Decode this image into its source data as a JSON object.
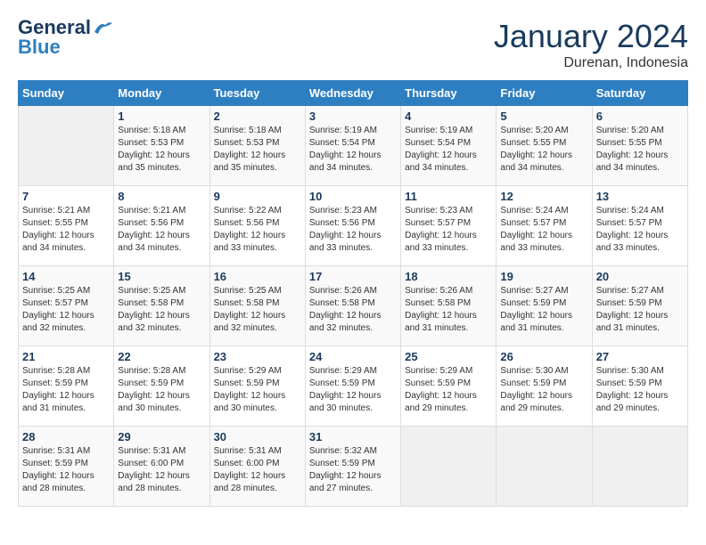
{
  "header": {
    "logo_line1": "General",
    "logo_line2": "Blue",
    "month_year": "January 2024",
    "location": "Durenan, Indonesia"
  },
  "columns": [
    "Sunday",
    "Monday",
    "Tuesday",
    "Wednesday",
    "Thursday",
    "Friday",
    "Saturday"
  ],
  "weeks": [
    [
      {
        "day": "",
        "info": ""
      },
      {
        "day": "1",
        "info": "Sunrise: 5:18 AM\nSunset: 5:53 PM\nDaylight: 12 hours\nand 35 minutes."
      },
      {
        "day": "2",
        "info": "Sunrise: 5:18 AM\nSunset: 5:53 PM\nDaylight: 12 hours\nand 35 minutes."
      },
      {
        "day": "3",
        "info": "Sunrise: 5:19 AM\nSunset: 5:54 PM\nDaylight: 12 hours\nand 34 minutes."
      },
      {
        "day": "4",
        "info": "Sunrise: 5:19 AM\nSunset: 5:54 PM\nDaylight: 12 hours\nand 34 minutes."
      },
      {
        "day": "5",
        "info": "Sunrise: 5:20 AM\nSunset: 5:55 PM\nDaylight: 12 hours\nand 34 minutes."
      },
      {
        "day": "6",
        "info": "Sunrise: 5:20 AM\nSunset: 5:55 PM\nDaylight: 12 hours\nand 34 minutes."
      }
    ],
    [
      {
        "day": "7",
        "info": "Sunrise: 5:21 AM\nSunset: 5:55 PM\nDaylight: 12 hours\nand 34 minutes."
      },
      {
        "day": "8",
        "info": "Sunrise: 5:21 AM\nSunset: 5:56 PM\nDaylight: 12 hours\nand 34 minutes."
      },
      {
        "day": "9",
        "info": "Sunrise: 5:22 AM\nSunset: 5:56 PM\nDaylight: 12 hours\nand 33 minutes."
      },
      {
        "day": "10",
        "info": "Sunrise: 5:23 AM\nSunset: 5:56 PM\nDaylight: 12 hours\nand 33 minutes."
      },
      {
        "day": "11",
        "info": "Sunrise: 5:23 AM\nSunset: 5:57 PM\nDaylight: 12 hours\nand 33 minutes."
      },
      {
        "day": "12",
        "info": "Sunrise: 5:24 AM\nSunset: 5:57 PM\nDaylight: 12 hours\nand 33 minutes."
      },
      {
        "day": "13",
        "info": "Sunrise: 5:24 AM\nSunset: 5:57 PM\nDaylight: 12 hours\nand 33 minutes."
      }
    ],
    [
      {
        "day": "14",
        "info": "Sunrise: 5:25 AM\nSunset: 5:57 PM\nDaylight: 12 hours\nand 32 minutes."
      },
      {
        "day": "15",
        "info": "Sunrise: 5:25 AM\nSunset: 5:58 PM\nDaylight: 12 hours\nand 32 minutes."
      },
      {
        "day": "16",
        "info": "Sunrise: 5:25 AM\nSunset: 5:58 PM\nDaylight: 12 hours\nand 32 minutes."
      },
      {
        "day": "17",
        "info": "Sunrise: 5:26 AM\nSunset: 5:58 PM\nDaylight: 12 hours\nand 32 minutes."
      },
      {
        "day": "18",
        "info": "Sunrise: 5:26 AM\nSunset: 5:58 PM\nDaylight: 12 hours\nand 31 minutes."
      },
      {
        "day": "19",
        "info": "Sunrise: 5:27 AM\nSunset: 5:59 PM\nDaylight: 12 hours\nand 31 minutes."
      },
      {
        "day": "20",
        "info": "Sunrise: 5:27 AM\nSunset: 5:59 PM\nDaylight: 12 hours\nand 31 minutes."
      }
    ],
    [
      {
        "day": "21",
        "info": "Sunrise: 5:28 AM\nSunset: 5:59 PM\nDaylight: 12 hours\nand 31 minutes."
      },
      {
        "day": "22",
        "info": "Sunrise: 5:28 AM\nSunset: 5:59 PM\nDaylight: 12 hours\nand 30 minutes."
      },
      {
        "day": "23",
        "info": "Sunrise: 5:29 AM\nSunset: 5:59 PM\nDaylight: 12 hours\nand 30 minutes."
      },
      {
        "day": "24",
        "info": "Sunrise: 5:29 AM\nSunset: 5:59 PM\nDaylight: 12 hours\nand 30 minutes."
      },
      {
        "day": "25",
        "info": "Sunrise: 5:29 AM\nSunset: 5:59 PM\nDaylight: 12 hours\nand 29 minutes."
      },
      {
        "day": "26",
        "info": "Sunrise: 5:30 AM\nSunset: 5:59 PM\nDaylight: 12 hours\nand 29 minutes."
      },
      {
        "day": "27",
        "info": "Sunrise: 5:30 AM\nSunset: 5:59 PM\nDaylight: 12 hours\nand 29 minutes."
      }
    ],
    [
      {
        "day": "28",
        "info": "Sunrise: 5:31 AM\nSunset: 5:59 PM\nDaylight: 12 hours\nand 28 minutes."
      },
      {
        "day": "29",
        "info": "Sunrise: 5:31 AM\nSunset: 6:00 PM\nDaylight: 12 hours\nand 28 minutes."
      },
      {
        "day": "30",
        "info": "Sunrise: 5:31 AM\nSunset: 6:00 PM\nDaylight: 12 hours\nand 28 minutes."
      },
      {
        "day": "31",
        "info": "Sunrise: 5:32 AM\nSunset: 5:59 PM\nDaylight: 12 hours\nand 27 minutes."
      },
      {
        "day": "",
        "info": ""
      },
      {
        "day": "",
        "info": ""
      },
      {
        "day": "",
        "info": ""
      }
    ]
  ]
}
